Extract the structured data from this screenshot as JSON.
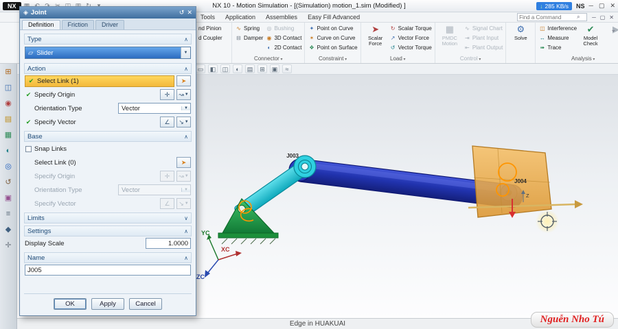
{
  "titlebar": {
    "logo": "NX",
    "title": "NX 10 - Motion Simulation - [(Simulation) motion_1.sim (Modified) ]",
    "net_arrow": "↓",
    "net_text": "285 KB/s",
    "ime": "NS",
    "btn_min": "─",
    "btn_max": "▢",
    "btn_close": "✕",
    "qat_icons": [
      {
        "name": "save-icon",
        "glyph": "▦"
      },
      {
        "name": "undo-icon",
        "glyph": "↶"
      },
      {
        "name": "redo-icon",
        "glyph": "↷"
      },
      {
        "name": "cut-icon",
        "glyph": "✂"
      },
      {
        "name": "copy-icon",
        "glyph": "◫"
      },
      {
        "name": "paste-icon",
        "glyph": "▥"
      },
      {
        "name": "repeat-command-icon",
        "glyph": "↻"
      },
      {
        "name": "qat-customize-icon",
        "glyph": "▾"
      }
    ]
  },
  "menubar": {
    "tabs": [
      "Tools",
      "Application",
      "Assemblies",
      "Easy Fill Advanced"
    ],
    "find_placeholder": "Find a Command",
    "btn_min": "─",
    "btn_restore": "▢",
    "btn_close": "✕"
  },
  "ribbon": {
    "partial": [
      "nd Pinion",
      "d Coupler"
    ],
    "connector": {
      "label": "Connector",
      "spring": "Spring",
      "damper": "Damper",
      "bushing": "Bushing",
      "c3d": "3D Contact",
      "c2d": "2D Contact"
    },
    "constraint": {
      "label": "Constraint",
      "i1": "Point on Curve",
      "i2": "Curve on Curve",
      "i3": "Point on Surface"
    },
    "load": {
      "label": "Load",
      "big": "Scalar Force",
      "i1": "Scalar Torque",
      "i2": "Vector Force",
      "i3": "Vector Torque"
    },
    "control": {
      "label": "Control",
      "big": "PMDC Motion",
      "i1": "Signal Chart",
      "i2": "Plant Input",
      "i3": "Plant Output"
    },
    "solve": {
      "big": "Solve"
    },
    "analysis": {
      "label": "Analysis",
      "i1": "Interference",
      "i2": "Measure",
      "i3": "Trace",
      "big1": "Model Check"
    }
  },
  "icons": {
    "gear1": "◫",
    "gear2": "◫",
    "spring": "∿",
    "damper": "⊟",
    "bushing": "◎",
    "contact3d": "◉",
    "contact2d": "◐",
    "point_on_curve": "✦",
    "curve_on_curve": "✶",
    "point_on_surface": "❖",
    "scalar_force": "➤",
    "scalar_torque": "↻",
    "vector_force": "↗",
    "vector_torque": "↺",
    "pmdc": "▦",
    "signal_chart": "∿",
    "plant_input": "⇥",
    "plant_output": "⇤",
    "solve": "⚙",
    "interference": "◫",
    "measure": "↔",
    "trace": "➠",
    "model_check": "✔",
    "animation": "▶",
    "ribbon_expand": "⌄",
    "search": "⌕",
    "joint": "◈",
    "dialog_reset": "↺",
    "dialog_close": "✕",
    "chev_up": "∧",
    "chev_down": "∨",
    "dd": "▼",
    "check": "✔",
    "select_cursor": "➤",
    "point_dialog": "✛",
    "curve_dd": "↝",
    "vector_dialog": "∠",
    "vector_dd": "↘",
    "slider_type": "▱"
  },
  "viewbar": {
    "icons": [
      {
        "name": "menu-icon",
        "glyph": "≡"
      },
      {
        "name": "selection-filter-icon",
        "glyph": "▾"
      },
      {
        "name": "select-scope-icon",
        "glyph": "□"
      },
      {
        "name": "snap-point-icon",
        "glyph": "⌖"
      },
      {
        "name": "point-snap-icon",
        "glyph": "✛"
      },
      {
        "name": "end-point-icon",
        "glyph": "◆"
      },
      {
        "name": "mid-point-icon",
        "glyph": "◇"
      },
      {
        "name": "intersection-icon",
        "glyph": "✚"
      },
      {
        "name": "arc-center-icon",
        "glyph": "◎"
      },
      {
        "name": "quadrant-icon",
        "glyph": "◑"
      },
      {
        "name": "existing-point-icon",
        "glyph": "∙"
      },
      {
        "name": "rotate-view-icon",
        "glyph": "↺"
      },
      {
        "name": "refresh-view-icon",
        "glyph": "↻"
      },
      {
        "name": "pan-view-icon",
        "glyph": "✥"
      },
      {
        "name": "fit-view-icon",
        "glyph": "▭"
      },
      {
        "name": "shaded-view-icon",
        "glyph": "◧"
      },
      {
        "name": "wireframe-view-icon",
        "glyph": "◫"
      },
      {
        "name": "show-hide-icon",
        "glyph": "◐"
      },
      {
        "name": "layer-settings-icon",
        "glyph": "▤"
      },
      {
        "name": "window-icon",
        "glyph": "⊞"
      },
      {
        "name": "object-display-icon",
        "glyph": "▣"
      },
      {
        "name": "section-view-icon",
        "glyph": "≈"
      }
    ]
  },
  "resource_bar": {
    "icons": [
      {
        "name": "motion-navigator-icon",
        "glyph": "⊞",
        "color": "#b06a20"
      },
      {
        "name": "assembly-navigator-icon",
        "glyph": "◫",
        "color": "#3f6fb0"
      },
      {
        "name": "constraint-navigator-icon",
        "glyph": "◉",
        "color": "#b04040"
      },
      {
        "name": "part-navigator-icon",
        "glyph": "▤",
        "color": "#c09020"
      },
      {
        "name": "reuse-library-icon",
        "glyph": "▦",
        "color": "#2e8b57"
      },
      {
        "name": "hd3d-tools-icon",
        "glyph": "◐",
        "color": "#20808a"
      },
      {
        "name": "web-browser-icon",
        "glyph": "◎",
        "color": "#2060c0"
      },
      {
        "name": "history-icon",
        "glyph": "↺",
        "color": "#806040"
      },
      {
        "name": "process-studio-icon",
        "glyph": "▣",
        "color": "#955090"
      },
      {
        "name": "manage-icon",
        "glyph": "≡",
        "color": "#5a6a7a"
      },
      {
        "name": "roles-icon",
        "glyph": "◆",
        "color": "#406080"
      },
      {
        "name": "touch-mode-icon",
        "glyph": "✛",
        "color": "#707a84"
      }
    ]
  },
  "dialog": {
    "title": "Joint",
    "tabs": [
      "Definition",
      "Friction",
      "Driver"
    ],
    "type": {
      "header": "Type",
      "value": "Slider"
    },
    "action": {
      "header": "Action",
      "select_link": "Select Link (1)",
      "specify_origin": "Specify Origin",
      "orientation_label": "Orientation Type",
      "orientation_value": "Vector",
      "specify_vector": "Specify Vector"
    },
    "base": {
      "header": "Base",
      "snap": "Snap Links",
      "select_link": "Select Link (0)",
      "specify_origin": "Specify Origin",
      "orientation_label": "Orientation Type",
      "orientation_value": "Vector",
      "specify_vector": "Specify Vector"
    },
    "limits": {
      "header": "Limits"
    },
    "settings": {
      "header": "Settings",
      "display_scale_label": "Display Scale",
      "display_scale_value": "1.0000"
    },
    "name": {
      "header": "Name",
      "value": "J005"
    },
    "ok": "OK",
    "apply": "Apply",
    "cancel": "Cancel"
  },
  "viewport": {
    "status": "Edge in HUAKUAI",
    "labels": {
      "j003": "J003",
      "j004": "J004",
      "z": "Z"
    },
    "triad": {
      "x": "XC",
      "y": "YC",
      "z": "ZC"
    }
  },
  "watermark": "Nguễn Nho Tú"
}
